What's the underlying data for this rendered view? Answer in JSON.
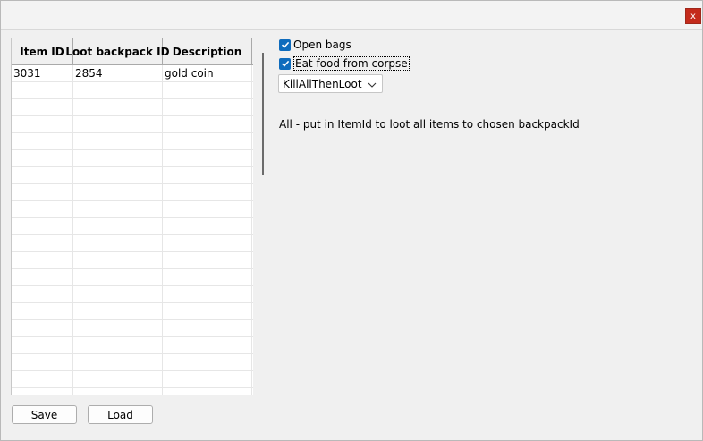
{
  "window": {
    "close_glyph": "x"
  },
  "grid": {
    "columns": [
      "Item ID",
      "Loot backpack ID",
      "Description"
    ],
    "rows": [
      [
        "3031",
        "2854",
        "gold coin"
      ],
      [
        "",
        "",
        ""
      ],
      [
        "",
        "",
        ""
      ],
      [
        "",
        "",
        ""
      ],
      [
        "",
        "",
        ""
      ],
      [
        "",
        "",
        ""
      ],
      [
        "",
        "",
        ""
      ],
      [
        "",
        "",
        ""
      ],
      [
        "",
        "",
        ""
      ],
      [
        "",
        "",
        ""
      ],
      [
        "",
        "",
        ""
      ],
      [
        "",
        "",
        ""
      ],
      [
        "",
        "",
        ""
      ],
      [
        "",
        "",
        ""
      ],
      [
        "",
        "",
        ""
      ],
      [
        "",
        "",
        ""
      ],
      [
        "",
        "",
        ""
      ],
      [
        "",
        "",
        ""
      ],
      [
        "",
        "",
        ""
      ],
      [
        "",
        "",
        ""
      ]
    ]
  },
  "options": {
    "open_bags": {
      "label": "Open bags",
      "checked": true
    },
    "eat_food": {
      "label": "Eat food from corpse",
      "checked": true
    },
    "mode_select": {
      "value": "KillAllThenLoot"
    },
    "hint": "All - put in ItemId to loot all items to chosen backpackId"
  },
  "buttons": {
    "save": "Save",
    "load": "Load"
  },
  "colors": {
    "accent": "#0f6cbd",
    "close": "#c42b1c"
  }
}
